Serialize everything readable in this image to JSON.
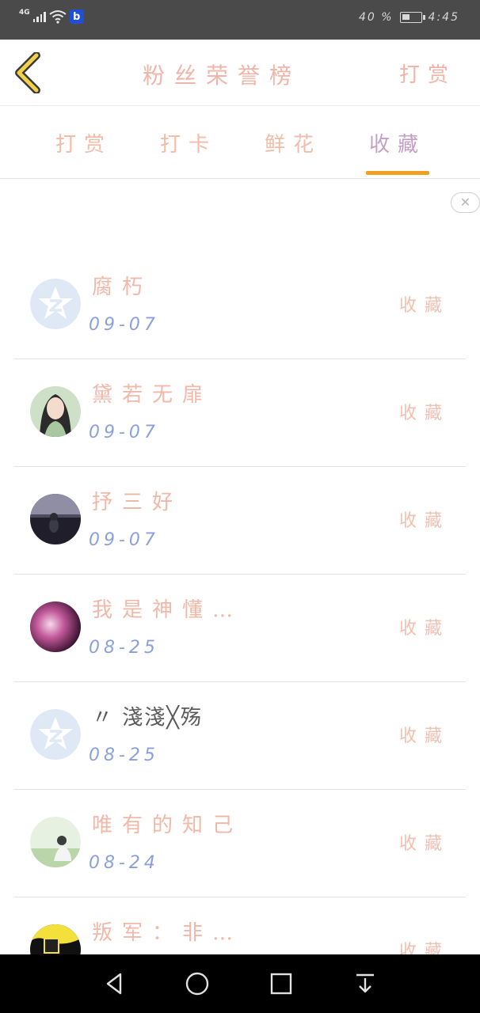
{
  "status_bar": {
    "network": "4G",
    "battery_percent": "40 %",
    "time": "4:45",
    "app_icon_letter": "b",
    "icons": [
      "signal-icon",
      "wifi-icon",
      "app-notification-icon",
      "battery-icon"
    ]
  },
  "header": {
    "back_icon": "chevron-left-icon",
    "title": "粉丝荣誉榜",
    "action": "打赏"
  },
  "tabs": [
    {
      "label": "打赏",
      "active": false
    },
    {
      "label": "打卡",
      "active": false
    },
    {
      "label": "鲜花",
      "active": false
    },
    {
      "label": "收藏",
      "active": true
    }
  ],
  "close_icon": "close-icon",
  "list": [
    {
      "name": "腐朽",
      "date": "09-07",
      "action": "收藏",
      "avatar": "default-star-avatar"
    },
    {
      "name": "黛若无扉",
      "date": "09-07",
      "action": "收藏",
      "avatar": "portrait-girl-avatar"
    },
    {
      "name": "抒三好",
      "date": "09-07",
      "action": "收藏",
      "avatar": "dusk-scene-avatar"
    },
    {
      "name": "我是神懂…",
      "date": "08-25",
      "action": "收藏",
      "avatar": "pink-blur-avatar"
    },
    {
      "name": "〃 淺淺╳殇",
      "date": "08-25",
      "action": "收藏",
      "avatar": "default-star-avatar"
    },
    {
      "name": "唯有的知己",
      "date": "08-24",
      "action": "收藏",
      "avatar": "outdoor-girl-avatar"
    },
    {
      "name": "叛军：非…",
      "date": "",
      "action": "收藏",
      "avatar": "yellow-dark-avatar"
    }
  ],
  "colors": {
    "status_bar_bg": "#4a4a4a",
    "accent_underline": "#f0a020",
    "back_icon_yellow": "#f2d04a",
    "name_pink": "#f1b8a8",
    "date_blue": "#8aa0dc",
    "nav_bg": "#000000"
  },
  "nav_bar": {
    "icons": [
      "back-triangle-icon",
      "home-circle-icon",
      "recents-square-icon",
      "notification-pulldown-icon"
    ]
  }
}
